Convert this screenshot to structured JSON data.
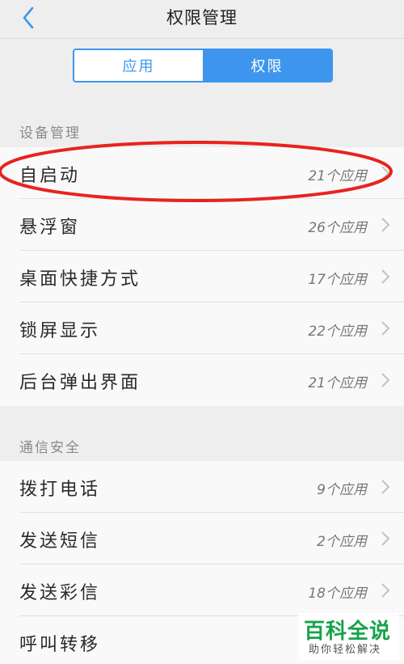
{
  "header": {
    "title": "权限管理",
    "back_icon": "chevron-left-icon"
  },
  "segment": {
    "tab_apps": "应用",
    "tab_permissions": "权限",
    "selected": "权限",
    "accent": "#3e95ee"
  },
  "sections": [
    {
      "label": "设备管理",
      "items": [
        {
          "name": "自启动",
          "count": "21个应用"
        },
        {
          "name": "悬浮窗",
          "count": "26个应用"
        },
        {
          "name": "桌面快捷方式",
          "count": "17个应用"
        },
        {
          "name": "锁屏显示",
          "count": "22个应用"
        },
        {
          "name": "后台弹出界面",
          "count": "21个应用"
        }
      ]
    },
    {
      "label": "通信安全",
      "items": [
        {
          "name": "拨打电话",
          "count": "9个应用"
        },
        {
          "name": "发送短信",
          "count": "2个应用"
        },
        {
          "name": "发送彩信",
          "count": "18个应用"
        },
        {
          "name": "呼叫转移",
          "count": ""
        }
      ]
    }
  ],
  "watermark": {
    "title": "百科全说",
    "subtitle": "助你轻松解决"
  },
  "annotation_color": "#e8231f"
}
